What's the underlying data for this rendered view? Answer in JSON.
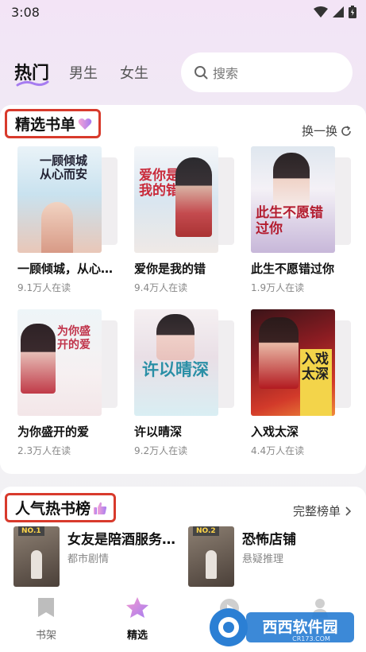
{
  "status": {
    "time": "3:08"
  },
  "tabs": [
    {
      "label": "热门",
      "active": true
    },
    {
      "label": "男生",
      "active": false
    },
    {
      "label": "女生",
      "active": false
    }
  ],
  "search": {
    "placeholder": "搜索"
  },
  "featured": {
    "title": "精选书单",
    "action": "换一换",
    "books": [
      {
        "title": "一顾倾城，从心…",
        "readers": "9.1万人在读",
        "cover_text": "一顾倾城从心而安"
      },
      {
        "title": "爱你是我的错",
        "readers": "9.4万人在读",
        "cover_text": "爱你是我的错"
      },
      {
        "title": "此生不愿错过你",
        "readers": "1.9万人在读",
        "cover_text": "此生不愿错过你"
      },
      {
        "title": "为你盛开的爱",
        "readers": "2.3万人在读",
        "cover_text": "为你盛开的爱"
      },
      {
        "title": "许以晴深",
        "readers": "9.2万人在读",
        "cover_text": "许以晴深"
      },
      {
        "title": "入戏太深",
        "readers": "4.4万人在读",
        "cover_text": "入戏太深"
      }
    ]
  },
  "ranking": {
    "title": "人气热书榜",
    "action": "完整榜单",
    "items": [
      {
        "badge": "NO.1",
        "title": "女友是陪酒服务…",
        "genre": "都市剧情"
      },
      {
        "badge": "NO.2",
        "title": "恐怖店铺",
        "genre": "悬疑推理"
      }
    ]
  },
  "bottom_nav": [
    {
      "label": "书架",
      "icon": "bookmark-icon",
      "active": false
    },
    {
      "label": "精选",
      "icon": "star-icon",
      "active": true
    }
  ],
  "watermark": {
    "text": "西西软件园",
    "sub": "CR173.COM"
  },
  "colors": {
    "accent": "#a67cf0",
    "highlight_border": "#d83a2c"
  }
}
